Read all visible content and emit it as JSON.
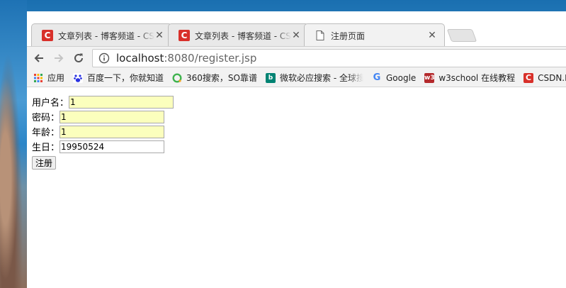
{
  "browser": {
    "tabs": [
      {
        "title": "文章列表 - 博客频道 - CSDN",
        "favicon": "C",
        "favicon_color": "#d8302a",
        "active": false
      },
      {
        "title": "文章列表 - 博客频道 - CSDN",
        "favicon": "C",
        "favicon_color": "#d8302a",
        "active": false
      },
      {
        "title": "注册页面",
        "favicon": "doc-icon",
        "active": true
      }
    ],
    "address_bar": {
      "host": "localhost",
      "path": ":8080/register.jsp"
    },
    "bookmarks": [
      {
        "label": "应用",
        "icon": "apps-grid-icon"
      },
      {
        "label": "百度一下，你就知道",
        "icon": "baidu-paw-icon",
        "color": "#2932e1"
      },
      {
        "label": "360搜索，SO靠谱",
        "icon": "360-icon",
        "color": "#3fb34f"
      },
      {
        "label": "微软必应搜索 - 全球搜索",
        "icon": "bing-icon",
        "color": "#008373"
      },
      {
        "label": "Google",
        "icon": "google-g-icon"
      },
      {
        "label": "w3school 在线教程",
        "icon": "w3-icon",
        "color": "#b4292c"
      },
      {
        "label": "CSDN.N",
        "icon": "csdn-icon",
        "color": "#d8302a"
      }
    ]
  },
  "form": {
    "username_label": "用户名：",
    "username_value": "1",
    "password_label": "密码：",
    "password_value": "1",
    "age_label": "年龄：",
    "age_value": "1",
    "birthday_label": "生日：",
    "birthday_value": "19950524",
    "submit_label": "注册"
  },
  "colors": {
    "autofill_bg": "#fbffbd",
    "csdn_red": "#d8302a"
  }
}
